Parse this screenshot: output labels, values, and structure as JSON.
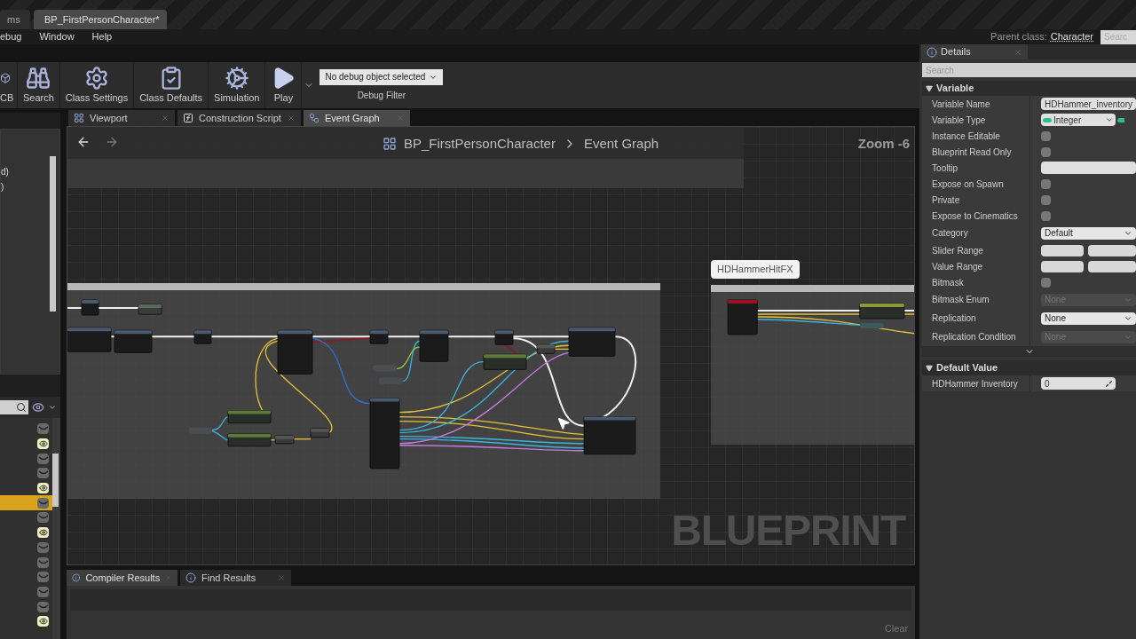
{
  "document_tabs": [
    {
      "label": "ms",
      "selected": false
    },
    {
      "label": "BP_FirstPersonCharacter*",
      "selected": true
    }
  ],
  "menu": [
    "ebug",
    "Window",
    "Help"
  ],
  "parent_class": {
    "label": "Parent class:",
    "value": "Character"
  },
  "top_search": {
    "placeholder": "Searc"
  },
  "toolbar": {
    "buttons": [
      {
        "kind": "cb",
        "label": "CB"
      },
      {
        "kind": "search",
        "label": "Search"
      },
      {
        "kind": "settings",
        "label": "Class Settings"
      },
      {
        "kind": "defaults",
        "label": "Class Defaults"
      },
      {
        "kind": "simulation",
        "label": "Simulation"
      },
      {
        "kind": "play",
        "label": "Play"
      }
    ],
    "debug_select": {
      "value": "No debug object selected",
      "label": "Debug Filter"
    }
  },
  "left_panel": {
    "lines": [
      "d)",
      ")"
    ],
    "items": [
      {
        "visible": false,
        "selected": false
      },
      {
        "visible": true,
        "selected": false
      },
      {
        "visible": false,
        "selected": false
      },
      {
        "visible": false,
        "selected": false
      },
      {
        "visible": true,
        "selected": false
      },
      {
        "visible": false,
        "selected": true
      },
      {
        "visible": false,
        "selected": false
      },
      {
        "visible": true,
        "selected": false
      },
      {
        "visible": false,
        "selected": false
      },
      {
        "visible": false,
        "selected": false
      },
      {
        "visible": false,
        "selected": false
      },
      {
        "visible": false,
        "selected": false
      },
      {
        "visible": false,
        "selected": false
      },
      {
        "visible": true,
        "selected": false
      }
    ]
  },
  "graph_tabs": [
    {
      "kind": "viewport",
      "label": "Viewport",
      "selected": false
    },
    {
      "kind": "function",
      "label": "Construction Script",
      "selected": false
    },
    {
      "kind": "graph",
      "label": "Event Graph",
      "selected": true
    }
  ],
  "graph": {
    "breadcrumb": [
      "BP_FirstPersonCharacter",
      "Event Graph"
    ],
    "zoom": "Zoom -6",
    "comment_bubble": "HDHammerHitFX",
    "graph_type_label": "BLUEPRINT"
  },
  "bottom_tabs": [
    {
      "label": "Compiler Results",
      "selected": true
    },
    {
      "label": "Find Results",
      "selected": false
    }
  ],
  "clear_button": "Clear",
  "details": {
    "title": "Details",
    "search": {
      "placeholder": "Search"
    },
    "sections": [
      {
        "title": "Variable",
        "expanded": true,
        "rows": [
          {
            "label": "Variable Name",
            "kind": "text",
            "value": "HDHammer_inventory"
          },
          {
            "label": "Variable Type",
            "kind": "type",
            "value": "Integer"
          },
          {
            "label": "Instance Editable",
            "kind": "checkbox",
            "checked": false
          },
          {
            "label": "Blueprint Read Only",
            "kind": "checkbox",
            "checked": false
          },
          {
            "label": "Tooltip",
            "kind": "text"
          },
          {
            "label": "Expose on Spawn",
            "kind": "checkbox",
            "checked": false
          },
          {
            "label": "Private",
            "kind": "checkbox",
            "checked": false
          },
          {
            "label": "Expose to Cinematics",
            "kind": "checkbox",
            "checked": false
          },
          {
            "label": "Category",
            "kind": "dropdown",
            "value": "Default",
            "disabled": false
          },
          {
            "label": "Slider Range",
            "kind": "range"
          },
          {
            "label": "Value Range",
            "kind": "range"
          },
          {
            "label": "Bitmask",
            "kind": "checkbox",
            "checked": false
          },
          {
            "label": "Bitmask Enum",
            "kind": "dropdown",
            "value": "None",
            "disabled": true
          },
          {
            "label": "Replication",
            "kind": "dropdown",
            "value": "None",
            "disabled": false
          },
          {
            "label": "Replication Condition",
            "kind": "dropdown",
            "value": "None",
            "disabled": true
          }
        ],
        "more": true
      },
      {
        "title": "Default Value",
        "expanded": true,
        "rows": [
          {
            "label": "HDHammer Inventory",
            "kind": "number",
            "value": "0"
          }
        ]
      }
    ]
  }
}
